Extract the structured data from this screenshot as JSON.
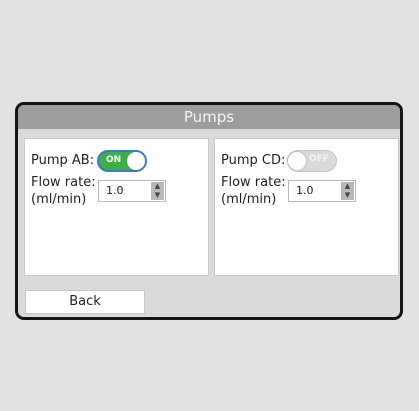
{
  "screen": {
    "title": "Pumps"
  },
  "pump_ab": {
    "label": "Pump AB:",
    "toggle_text": "ON",
    "enabled": true,
    "flow_label_1": "Flow rate:",
    "flow_label_2": "(ml/min)",
    "flow_value": "1.0"
  },
  "pump_cd": {
    "label": "Pump CD:",
    "toggle_text": "OFF",
    "enabled": false,
    "flow_label_1": "Flow rate:",
    "flow_label_2": "(ml/min)",
    "flow_value": "1.0"
  },
  "footer": {
    "back_label": "Back"
  },
  "icons": {
    "spinner": "chevron-up-down-icon"
  },
  "colors": {
    "toggle_on": "#41ad4a",
    "toggle_off": "#d9d9d9",
    "title_bar": "#9d9d9d"
  }
}
